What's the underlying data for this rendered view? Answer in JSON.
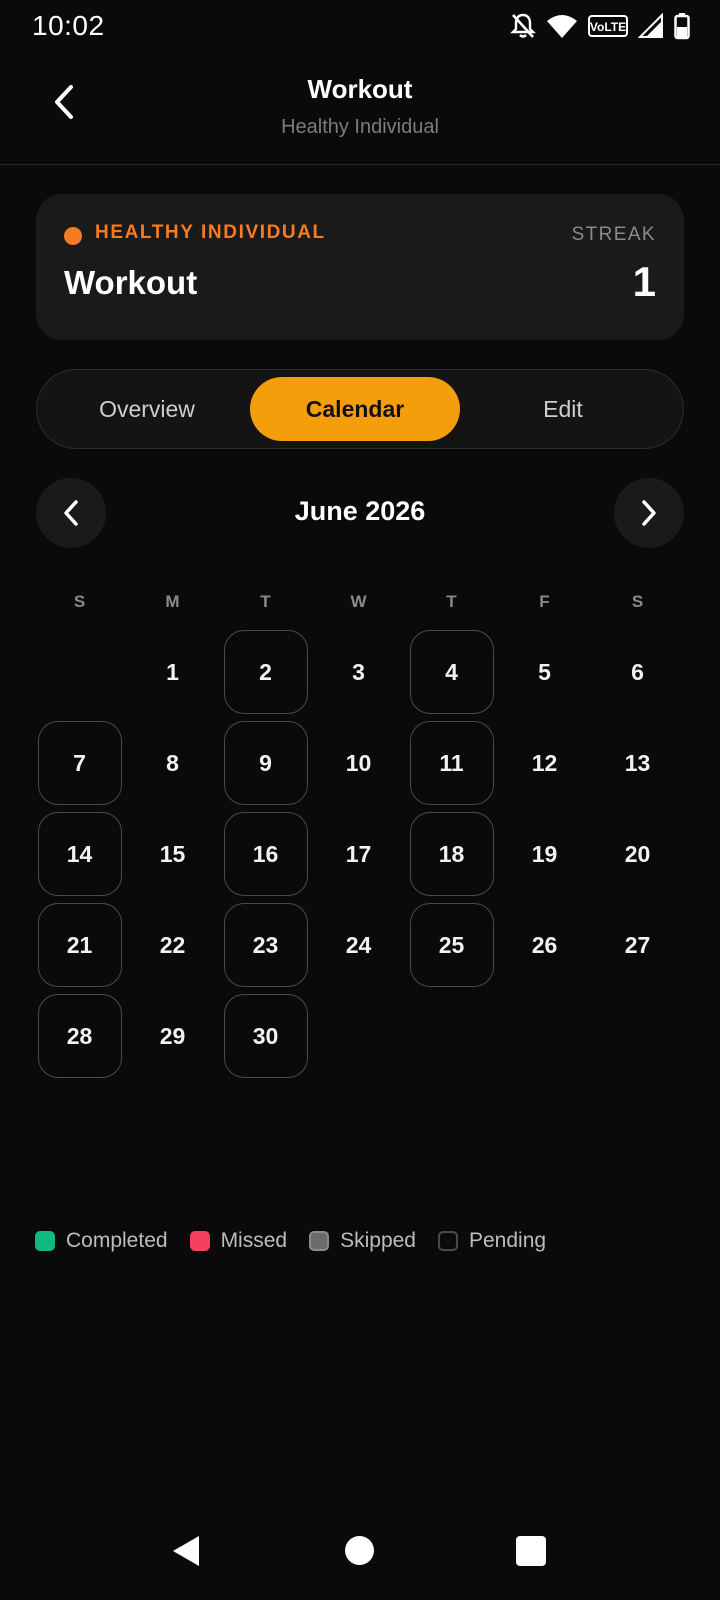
{
  "status_bar": {
    "time": "10:02",
    "icons": [
      "notifications-off-icon",
      "wifi-icon",
      "volte-icon",
      "signal-icon",
      "battery-icon"
    ],
    "volte_text": "VoLTE"
  },
  "app_bar": {
    "title": "Workout",
    "subtitle": "Healthy Individual",
    "back_icon": "chevron-left-icon"
  },
  "habit_card": {
    "category": "HEALTHY INDIVIDUAL",
    "category_color": "#f57c22",
    "name": "Workout",
    "streak_label": "STREAK",
    "streak_value": "1"
  },
  "tabs": [
    {
      "label": "Overview",
      "active": false
    },
    {
      "label": "Calendar",
      "active": true
    },
    {
      "label": "Edit",
      "active": false
    }
  ],
  "accent_color": "#f59e0b",
  "calendar": {
    "month_label": "June 2026",
    "weekdays": [
      "S",
      "M",
      "T",
      "W",
      "T",
      "F",
      "S"
    ],
    "first_weekday_index": 1,
    "days_in_month": 30,
    "pending_days": [
      2,
      4,
      7,
      9,
      11,
      14,
      16,
      18,
      21,
      23,
      25,
      28,
      30
    ]
  },
  "legend": [
    {
      "label": "Completed",
      "color": "#10b981",
      "style": "filled"
    },
    {
      "label": "Missed",
      "color": "#f43f5e",
      "style": "filled"
    },
    {
      "label": "Skipped",
      "color": "#6b6b6b",
      "style": "filled"
    },
    {
      "label": "Pending",
      "color": "#4a4a4a",
      "style": "outline"
    }
  ]
}
